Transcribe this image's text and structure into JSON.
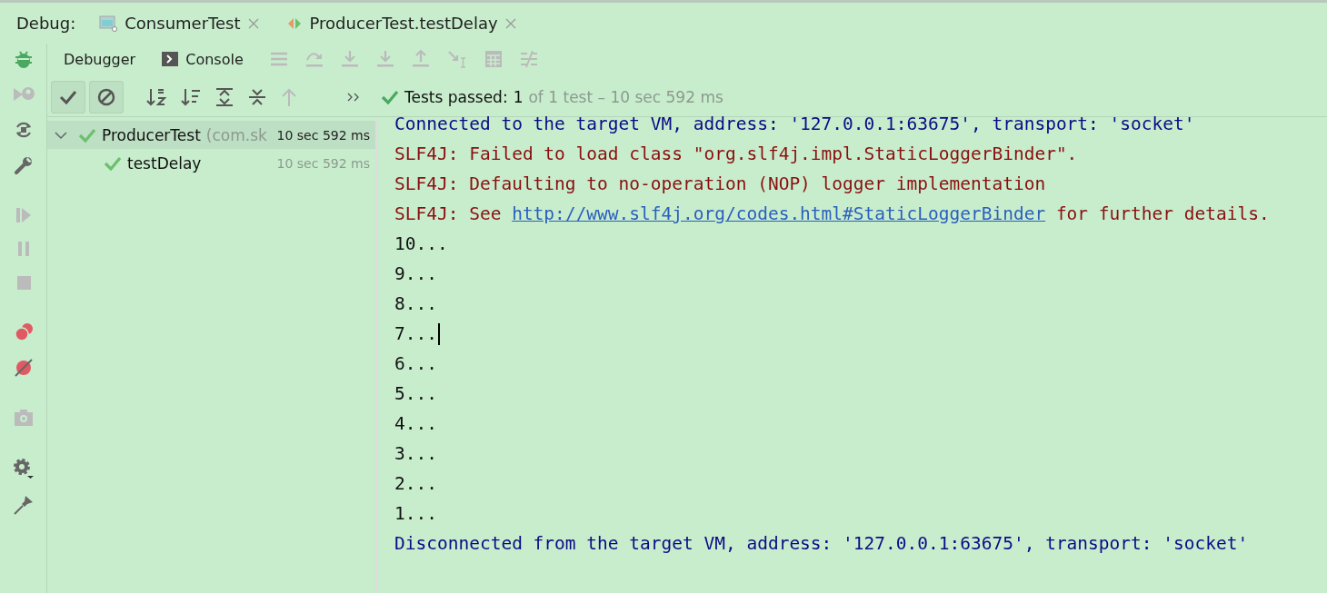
{
  "debug_bar": {
    "label": "Debug:",
    "tabs": [
      {
        "label": "ConsumerTest",
        "kind": "class"
      },
      {
        "label": "ProducerTest.testDelay",
        "kind": "method"
      }
    ]
  },
  "toolbar": {
    "tabs": [
      {
        "label": "Debugger",
        "kind": "debugger"
      },
      {
        "label": "Console",
        "kind": "console"
      }
    ]
  },
  "test_toolbar": {
    "toggles": [
      {
        "kind": "passed",
        "on": true
      },
      {
        "kind": "ignored",
        "on": true
      }
    ]
  },
  "status": {
    "label": "Tests passed:",
    "count": "1",
    "detail": "of 1 test – 10 sec 592 ms"
  },
  "tree": [
    {
      "name": "ProducerTest",
      "detail": "(com.sk",
      "time": "10 sec 592 ms",
      "selected": true,
      "expanded": true,
      "children": [
        {
          "name": "testDelay",
          "time": "10 sec 592 ms",
          "selected": false
        }
      ]
    }
  ],
  "console": [
    {
      "kind": "info",
      "text": "Connected to the target VM, address: '127.0.0.1:63675', transport: 'socket'"
    },
    {
      "kind": "error",
      "text": "SLF4J: Failed to load class \"org.slf4j.impl.StaticLoggerBinder\"."
    },
    {
      "kind": "error",
      "text": "SLF4J: Defaulting to no-operation (NOP) logger implementation"
    },
    {
      "kind": "link",
      "text": "SLF4J: See ",
      "link": "http://www.slf4j.org/codes.html#StaticLoggerBinder",
      "after": " for further details."
    },
    {
      "kind": "output",
      "text": "10..."
    },
    {
      "kind": "output",
      "text": "9..."
    },
    {
      "kind": "output",
      "text": "8..."
    },
    {
      "kind": "output",
      "text": "7...",
      "cursor": true
    },
    {
      "kind": "output",
      "text": "6..."
    },
    {
      "kind": "output",
      "text": "5..."
    },
    {
      "kind": "output",
      "text": "4..."
    },
    {
      "kind": "output",
      "text": "3..."
    },
    {
      "kind": "output",
      "text": "2..."
    },
    {
      "kind": "output",
      "text": "1..."
    },
    {
      "kind": "info",
      "text": "Disconnected from the target VM, address: '127.0.0.1:63675', transport: 'socket'"
    }
  ]
}
